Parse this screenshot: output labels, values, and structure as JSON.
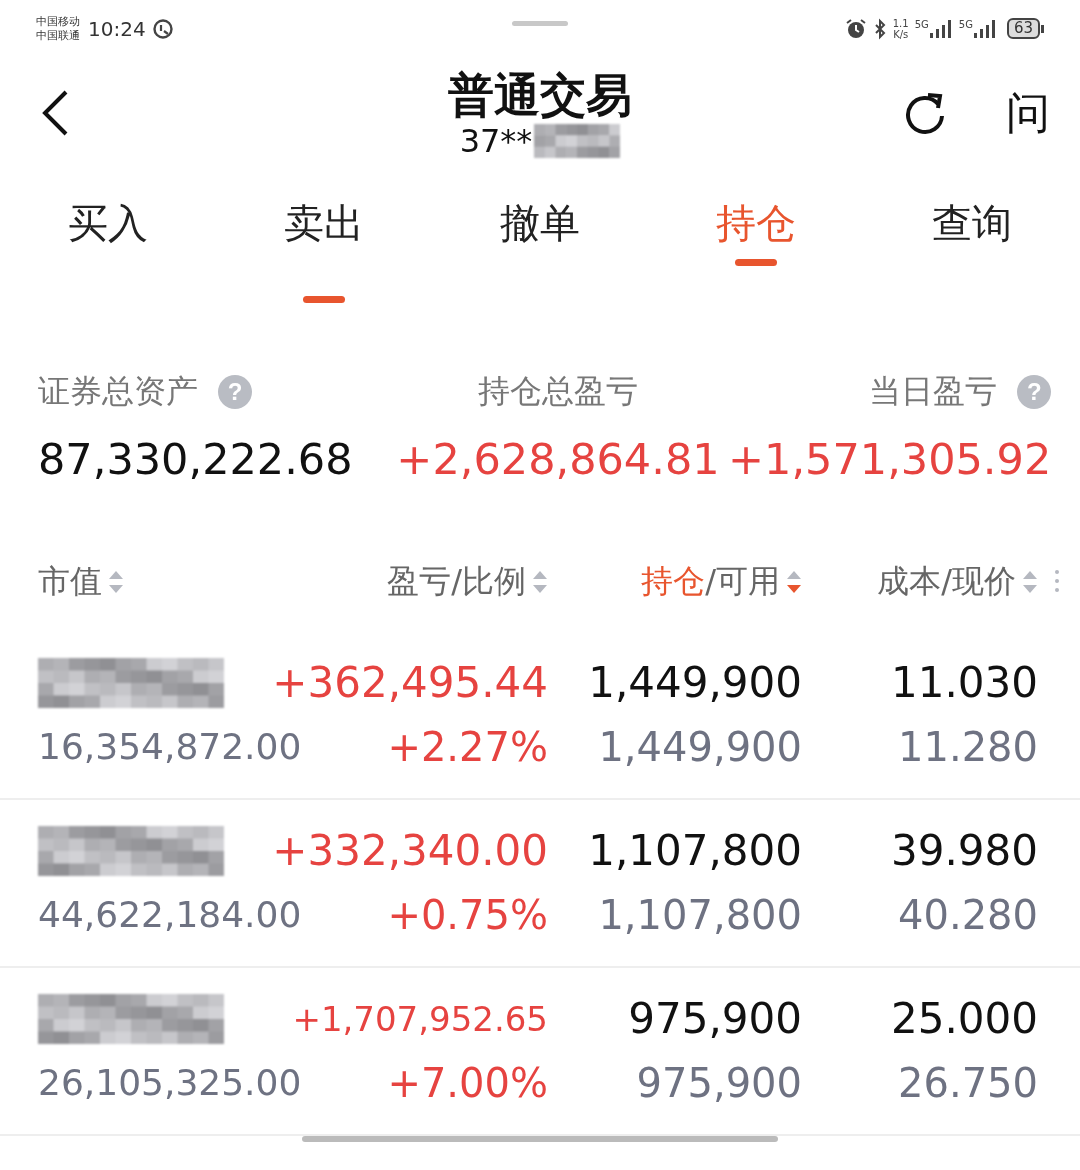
{
  "status_bar": {
    "carriers": [
      "中国移动",
      "中国联通"
    ],
    "time": "10:24",
    "speed": [
      "1.1",
      "K/s"
    ],
    "networks": [
      "5G",
      "5G"
    ],
    "battery": "63"
  },
  "header": {
    "title": "普通交易",
    "account": "37**",
    "account_redacted": true,
    "help": "问"
  },
  "tabs": [
    {
      "label": "买入",
      "selected": false,
      "trail": false
    },
    {
      "label": "卖出",
      "selected": false,
      "trail": true
    },
    {
      "label": "撤单",
      "selected": false,
      "trail": false
    },
    {
      "label": "持仓",
      "selected": true,
      "trail": false
    },
    {
      "label": "查询",
      "selected": false,
      "trail": false
    }
  ],
  "summary": [
    {
      "label": "证券总资产",
      "help": "?",
      "value": "87,330,222.68",
      "color": "#111111"
    },
    {
      "label": "持仓总盈亏",
      "value": "+2,628,864.81",
      "color": "#e64340"
    },
    {
      "label": "当日盈亏",
      "help": "?",
      "value": "+1,571,305.92",
      "color": "#e64340"
    }
  ],
  "columns": [
    {
      "label_parts": [
        "市值"
      ],
      "selected": false
    },
    {
      "label_parts": [
        "盈亏/比例"
      ],
      "selected": false
    },
    {
      "label_parts": [
        "持仓",
        "/可用"
      ],
      "selected": true
    },
    {
      "label_parts": [
        "成本/现价"
      ],
      "selected": false
    }
  ],
  "rows": [
    {
      "name_redacted": true,
      "market_value": "16,354,872.00",
      "profit": "+362,495.44",
      "ratio": "+2.27%",
      "holding": "1,449,900",
      "available": "1,449,900",
      "cost": "11.030",
      "price": "11.280"
    },
    {
      "name_redacted": true,
      "market_value": "44,622,184.00",
      "profit": "+332,340.00",
      "ratio": "+0.75%",
      "holding": "1,107,800",
      "available": "1,107,800",
      "cost": "39.980",
      "price": "40.280"
    },
    {
      "name_redacted": true,
      "market_value": "26,105,325.00",
      "profit": "+1,707,952.65",
      "ratio": "+7.00%",
      "holding": "975,900",
      "available": "975,900",
      "cost": "25.000",
      "price": "26.750"
    }
  ]
}
